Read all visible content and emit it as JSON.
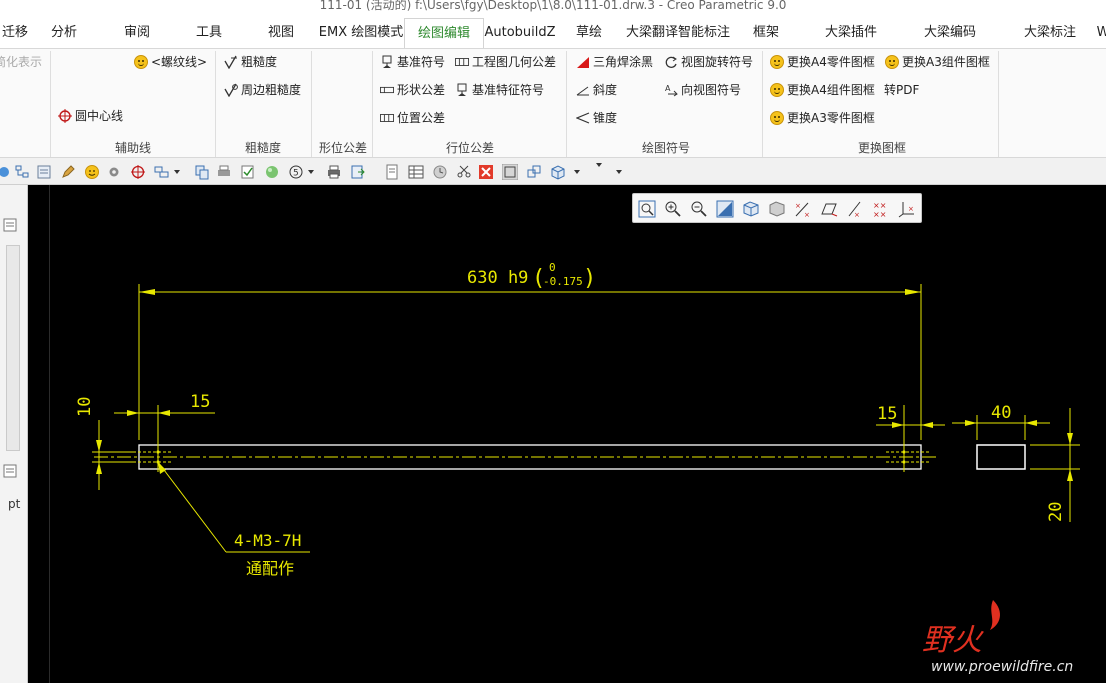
{
  "window": {
    "title": "111-01 (活动的) f:\\Users\\fgy\\Desktop\\1\\8.0\\111-01.drw.3 - Creo Parametric 9.0"
  },
  "menu": {
    "tabs": [
      "迁移",
      "分析",
      "审阅",
      "工具",
      "视图",
      "EMX 绘图模式",
      "绘图编辑",
      "AutobuildZ",
      "草绘",
      "大梁翻译智能标注",
      "框架",
      "大梁插件",
      "大梁编码",
      "大梁标注",
      "W"
    ],
    "active_tab": "绘图编辑"
  },
  "ribbon": {
    "simplified_label": "简化表示",
    "groups": {
      "aux_lines": {
        "label": "辅助线",
        "thread_line": "<螺纹线>",
        "circle_center_line": "圆中心线"
      },
      "roughness": {
        "label": "粗糙度",
        "roughness": "粗糙度",
        "perimeter_roughness": "周边粗糙度"
      },
      "form_tolerance": {
        "label": "形位公差"
      },
      "position_tolerance": {
        "label": "行位公差",
        "datum_symbol": "基准符号",
        "drawing_geometric_tolerance": "工程图几何公差",
        "shape_tolerance": "形状公差",
        "datum_feature_symbol": "基准特征符号",
        "position_tolerance": "位置公差"
      },
      "drawing_symbols": {
        "label": "绘图符号",
        "triangle_weld_fill": "三角焊涂黑",
        "view_rotation_symbol": "视图旋转符号",
        "slope": "斜度",
        "direction_view_symbol": "向视图符号",
        "taper": "锥度"
      },
      "replace_frame": {
        "label": "更换图框",
        "a4_part_frame": "更换A4零件图框",
        "a3_assembly_frame": "更换A3组件图框",
        "a4_assembly_frame": "更换A4组件图框",
        "to_pdf": "转PDF",
        "a3_part_frame": "更换A3零件图框"
      }
    }
  },
  "left_panel": {
    "label": "pt"
  },
  "drawing": {
    "overall_dim": "630 h9",
    "tol_upper": "0",
    "tol_lower": "-0.175",
    "dim_left_hole": "15",
    "dim_right_hole": "15",
    "dim_height": "10",
    "dim_section_width": "40",
    "dim_section_height": "20",
    "note_thread": "4-M3-7H",
    "note_match": "通配作"
  },
  "watermark": {
    "cn": "野火",
    "url": "www.proewildfire.cn"
  },
  "colors": {
    "cad_yellow": "#e8e800",
    "part_white": "#ffffff",
    "background": "#000000",
    "active_tab": "#2f8a2f",
    "watermark_red": "#e03020"
  }
}
